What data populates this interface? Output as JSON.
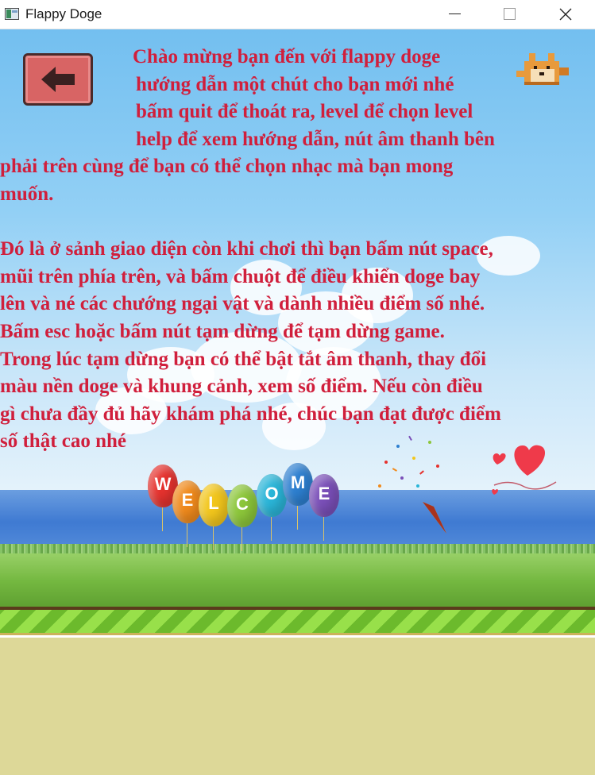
{
  "window": {
    "title": "Flappy Doge"
  },
  "screen": {
    "back_button_icon": "arrow-left-icon",
    "character_icon": "doge-icon",
    "instructions": [
      "Chào mừng bạn đến với flappy doge",
      "hướng dẫn một chút cho bạn mới nhé",
      "bấm quit để thoát ra, level để chọn level",
      "help để xem hướng dẫn, nút âm thanh bên",
      "phải trên cùng để bạn có thể chọn nhạc mà bạn mong",
      "muốn.",
      "Đó là ở sảnh giao diện còn khi chơi thì bạn bấm nút space,",
      "mũi trên phía trên, và bấm chuột để điều khiển doge bay",
      "lên và né các chướng ngại vật và dành nhiều điểm số nhé.",
      "Bấm esc hoặc bấm nút tạm dừng để tạm dừng game.",
      "Trong lúc tạm dừng bạn có thể bật tắt âm thanh, thay đổi",
      "màu nền doge và khung cảnh, xem số điểm. Nếu còn điều",
      "gì chưa đầy đủ hãy khám phá nhé, chúc bạn đạt được điểm",
      "số thật cao nhé"
    ],
    "welcome_letters": [
      "W",
      "E",
      "L",
      "C",
      "O",
      "M",
      "E"
    ],
    "colors": {
      "text": "#d01f3c",
      "back_button": "#d86464",
      "sky": "#73bff0",
      "sea": "#3f7ad2",
      "grass": "#74b840",
      "ground": "#ddd898"
    }
  }
}
